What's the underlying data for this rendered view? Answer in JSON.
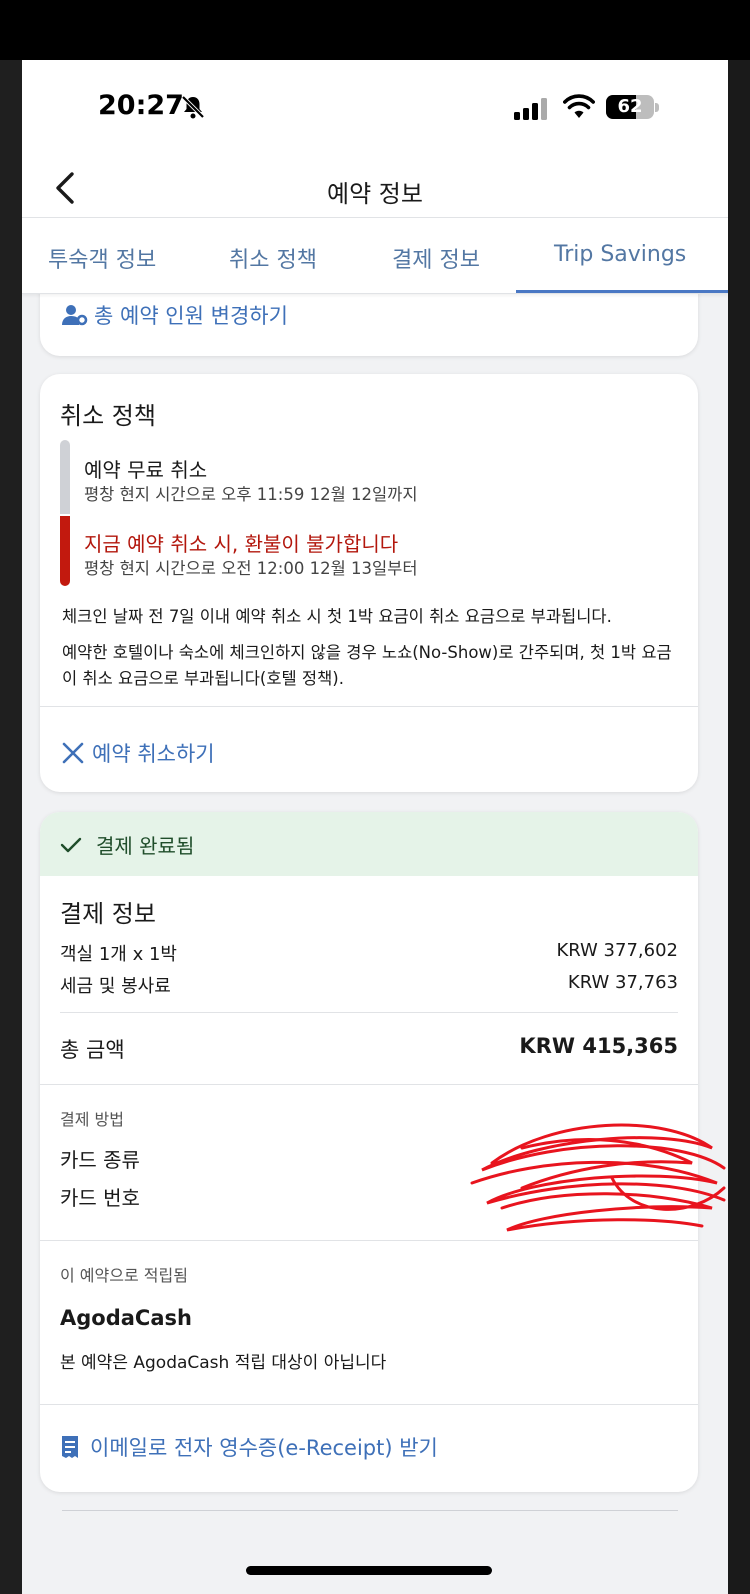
{
  "status_bar": {
    "time": "20:27",
    "battery": "62",
    "battery_level": 0.62
  },
  "header": {
    "title": "예약 정보",
    "back_icon": "chevron-left-icon"
  },
  "tabs": [
    {
      "label": "투숙객 정보",
      "active": false
    },
    {
      "label": "취소 정책",
      "active": false
    },
    {
      "label": "결제 정보",
      "active": false
    },
    {
      "label": "Trip Savings",
      "active": true
    }
  ],
  "guests_card": {
    "change_guests_link": "총 예약 인원 변경하기"
  },
  "cancellation": {
    "title": "취소 정책",
    "free_cancel_title": "예약 무료 취소",
    "free_cancel_sub": "평창 현지 시간으로 오후 11:59 12월 12일까지",
    "nonrefundable_title": "지금 예약 취소 시, 환불이 불가합니다",
    "nonrefundable_sub": "평창 현지 시간으로 오전 12:00 12월 13일부터",
    "note1": "체크인 날짜 전 7일 이내 예약 취소 시 첫 1박 요금이 취소 요금으로 부과됩니다.",
    "note2": "예약한 호텔이나 숙소에 체크인하지 않을 경우 노쇼(No-Show)로 간주되며, 첫 1박 요금이 취소 요금으로 부과됩니다(호텔 정책).",
    "cancel_link": "예약 취소하기"
  },
  "payment": {
    "status": "결제 완료됨",
    "title": "결제 정보",
    "room_label": "객실 1개 x 1박",
    "room_value": "KRW 377,602",
    "tax_label": "세금 및 봉사료",
    "tax_value": "KRW 37,763",
    "total_label": "총 금액",
    "total_value": "KRW 415,365",
    "method_heading": "결제 방법",
    "card_type_label": "카드 종류",
    "card_number_label": "카드 번호",
    "earned_heading": "이 예약으로 적립됨",
    "agodacash_title": "AgodaCash",
    "agodacash_text": "본 예약은 AgodaCash 적립 대상이 아닙니다",
    "receipt_link": "이메일로 전자 영수증(e-Receipt) 받기"
  },
  "colors": {
    "link": "#3e70b8",
    "tab": "#5377a3",
    "danger": "#c2190e",
    "success_bg": "#e5f3e8",
    "redaction": "#e8141e"
  }
}
